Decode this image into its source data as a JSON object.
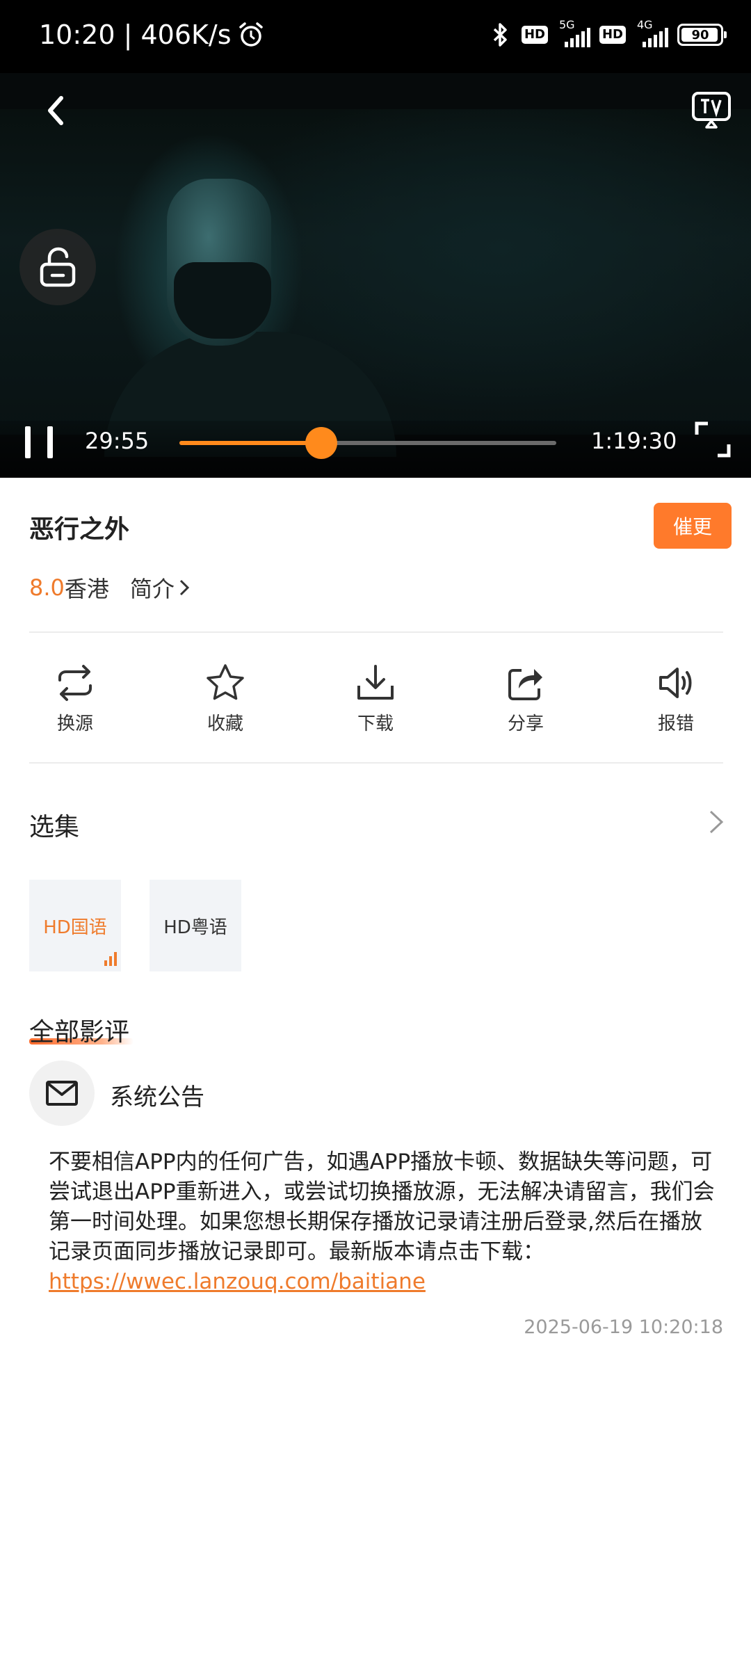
{
  "status_bar": {
    "time_speed": "10:20 | 406K/s",
    "hd_badge": "HD",
    "net_1": "5G",
    "net_2": "4G",
    "battery": "90"
  },
  "player": {
    "current_time": "29:55",
    "duration": "1:19:30",
    "progress_fraction": 0.376
  },
  "title": "恶行之外",
  "urge_button": "催更",
  "meta": {
    "rating": "8.0",
    "region": "香港",
    "intro": "简介"
  },
  "actions": [
    {
      "label": "换源",
      "icon": "switch-source-icon"
    },
    {
      "label": "收藏",
      "icon": "star-icon"
    },
    {
      "label": "下载",
      "icon": "download-icon"
    },
    {
      "label": "分享",
      "icon": "share-icon"
    },
    {
      "label": "报错",
      "icon": "speaker-icon"
    }
  ],
  "episodes": {
    "label": "选集",
    "items": [
      {
        "label": "HD国语",
        "active": true
      },
      {
        "label": "HD粤语",
        "active": false
      }
    ]
  },
  "reviews": {
    "title": "全部影评",
    "notice": {
      "name": "系统公告",
      "body": "不要相信APP内的任何广告，如遇APP播放卡顿、数据缺失等问题，可尝试退出APP重新进入，或尝试切换播放源，无法解决请留言，我们会第一时间处理。如果您想长期保存播放记录请注册后登录,然后在播放记录页面同步播放记录即可。最新版本请点击下载：",
      "link": "https://wwec.lanzouq.com/baitiane",
      "date": "2025-06-19 10:20:18"
    }
  },
  "colors": {
    "accent": "#ef7b2c",
    "button": "#ff7a2b",
    "progress": "#ff8a1c"
  }
}
